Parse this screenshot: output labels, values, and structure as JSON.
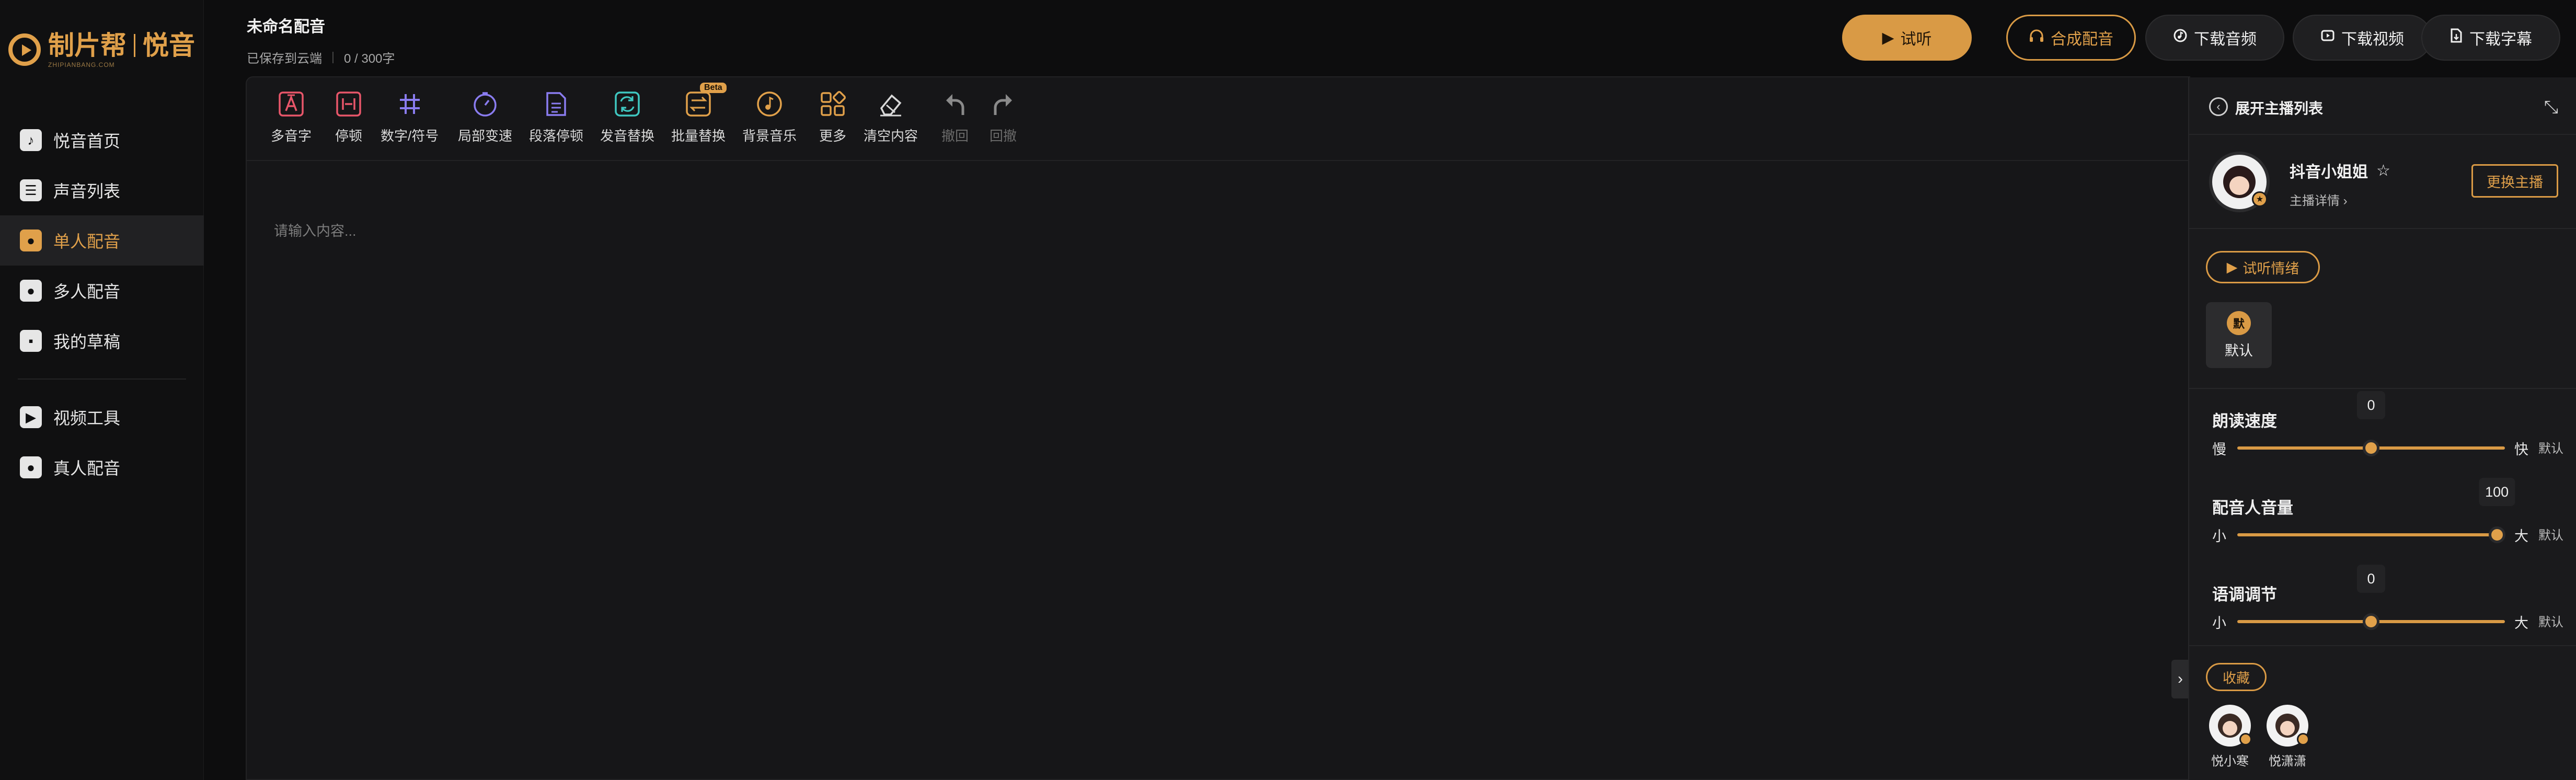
{
  "app": {
    "brand_name": "制片帮",
    "product_name": "悦音",
    "brand_sub": "ZHIPIANBANG.COM"
  },
  "sidebar": {
    "items": [
      {
        "label": "悦音首页",
        "icon": "music-note-icon"
      },
      {
        "label": "声音列表",
        "icon": "list-icon"
      },
      {
        "label": "单人配音",
        "icon": "single-person-icon",
        "active": true
      },
      {
        "label": "多人配音",
        "icon": "multi-person-icon"
      },
      {
        "label": "我的草稿",
        "icon": "draft-icon"
      },
      {
        "label": "视频工具",
        "icon": "video-camera-icon"
      },
      {
        "label": "真人配音",
        "icon": "real-person-icon"
      }
    ]
  },
  "header": {
    "title": "未命名配音",
    "save_status": "已保存到云端",
    "char_count": "0 / 300字",
    "buttons": {
      "listen": "试听",
      "synthesize": "合成配音",
      "download_audio": "下载音频",
      "download_video": "下载视频",
      "download_subtitle": "下载字幕"
    }
  },
  "toolbar": {
    "tools": [
      {
        "label": "多音字",
        "icon": "polyphone-icon"
      },
      {
        "label": "停顿",
        "icon": "pause-icon"
      },
      {
        "label": "数字/符号",
        "icon": "hash-icon"
      },
      {
        "label": "局部变速",
        "icon": "speed-icon"
      },
      {
        "label": "段落停顿",
        "icon": "paragraph-pause-icon"
      },
      {
        "label": "发音替换",
        "icon": "pronounce-replace-icon"
      },
      {
        "label": "批量替换",
        "icon": "batch-replace-icon",
        "badge": "Beta"
      },
      {
        "label": "背景音乐",
        "icon": "bgm-icon"
      },
      {
        "label": "更多",
        "icon": "more-grid-icon"
      },
      {
        "label": "清空内容",
        "icon": "eraser-icon"
      },
      {
        "label": "撤回",
        "icon": "undo-icon",
        "disabled": true
      },
      {
        "label": "回撤",
        "icon": "redo-icon",
        "disabled": true
      }
    ]
  },
  "editor": {
    "placeholder": "请输入内容..."
  },
  "panel": {
    "header_title": "展开主播列表",
    "anchor": {
      "name": "抖音小姐姐",
      "detail": "主播详情",
      "change_button": "更换主播"
    },
    "emotion_button": "试听情绪",
    "emotion_default": {
      "badge": "默",
      "label": "默认"
    },
    "sliders": [
      {
        "title": "朗读速度",
        "value": "0",
        "fraction": 0.5,
        "low": "慢",
        "high": "快",
        "default": "默认"
      },
      {
        "title": "配音人音量",
        "value": "100",
        "fraction": 0.97,
        "low": "小",
        "high": "大",
        "default": "默认"
      },
      {
        "title": "语调调节",
        "value": "0",
        "fraction": 0.5,
        "low": "小",
        "high": "大",
        "default": "默认"
      }
    ],
    "favorites_label": "收藏",
    "favorites": [
      {
        "name": "悦小寒"
      },
      {
        "name": "悦潇潇"
      }
    ]
  },
  "colors": {
    "accent": "#d99a45",
    "background": "#0d0d0e",
    "sidebar_active_bg": "#212123"
  }
}
